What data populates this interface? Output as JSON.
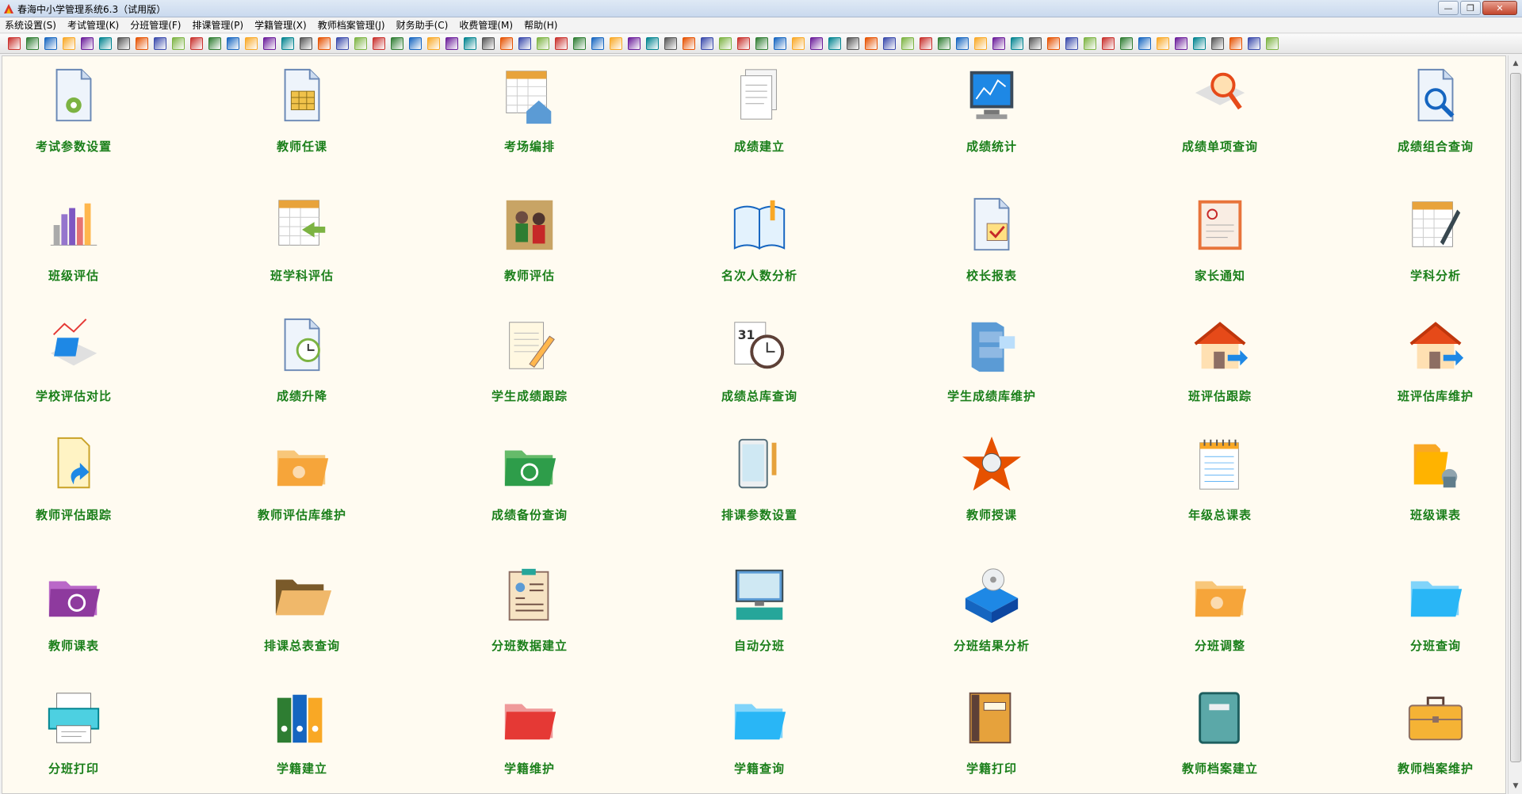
{
  "window": {
    "title": "春海中小学管理系统6.3（试用版）"
  },
  "menu": [
    "系统设置(S)",
    "考试管理(K)",
    "分班管理(F)",
    "排课管理(P)",
    "学籍管理(X)",
    "教师档案管理(J)",
    "财务助手(C)",
    "收费管理(M)",
    "帮助(H)"
  ],
  "tiles": [
    {
      "label": "考试参数设置",
      "icon": "document-settings-icon"
    },
    {
      "label": "教师任课",
      "icon": "document-table-icon"
    },
    {
      "label": "考场编排",
      "icon": "calendar-house-icon"
    },
    {
      "label": "成绩建立",
      "icon": "document-stack-icon"
    },
    {
      "label": "成绩统计",
      "icon": "monitor-chart-icon"
    },
    {
      "label": "成绩单项查询",
      "icon": "magnifier-paper-icon"
    },
    {
      "label": "成绩组合查询",
      "icon": "document-search-icon"
    },
    {
      "label": "班级评估",
      "icon": "bar-chart-icon"
    },
    {
      "label": "班学科评估",
      "icon": "calendar-arrow-icon"
    },
    {
      "label": "教师评估",
      "icon": "teachers-photo-icon"
    },
    {
      "label": "名次人数分析",
      "icon": "open-book-icon"
    },
    {
      "label": "校长报表",
      "icon": "document-check-icon"
    },
    {
      "label": "家长通知",
      "icon": "letter-icon"
    },
    {
      "label": "学科分析",
      "icon": "calendar-pen-icon"
    },
    {
      "label": "学校评估对比",
      "icon": "trend-chart-icon"
    },
    {
      "label": "成绩升降",
      "icon": "document-clock-icon"
    },
    {
      "label": "学生成绩跟踪",
      "icon": "notepad-pen-icon"
    },
    {
      "label": "成绩总库查询",
      "icon": "calendar-clock-icon"
    },
    {
      "label": "学生成绩库维护",
      "icon": "cabinet-icon"
    },
    {
      "label": "班评估跟踪",
      "icon": "house-arrow-icon"
    },
    {
      "label": "班评估库维护",
      "icon": "house-arrow-icon"
    },
    {
      "label": "教师评估跟踪",
      "icon": "document-arrow-icon"
    },
    {
      "label": "教师评估库维护",
      "icon": "orange-folder-icon"
    },
    {
      "label": "成绩备份查询",
      "icon": "green-folder-icon"
    },
    {
      "label": "排课参数设置",
      "icon": "tablet-pen-icon"
    },
    {
      "label": "教师授课",
      "icon": "star-portrait-icon"
    },
    {
      "label": "年级总课表",
      "icon": "spiral-notepad-icon"
    },
    {
      "label": "班级课表",
      "icon": "folder-lock-icon"
    },
    {
      "label": "教师课表",
      "icon": "purple-folder-icon"
    },
    {
      "label": "排课总表查询",
      "icon": "open-folder-icon"
    },
    {
      "label": "分班数据建立",
      "icon": "clipboard-person-icon"
    },
    {
      "label": "自动分班",
      "icon": "computer-icon"
    },
    {
      "label": "分班结果分析",
      "icon": "toolbox-disc-icon"
    },
    {
      "label": "分班调整",
      "icon": "orange-folder-icon"
    },
    {
      "label": "分班查询",
      "icon": "blue-folder-icon"
    },
    {
      "label": "分班打印",
      "icon": "printer-icon"
    },
    {
      "label": "学籍建立",
      "icon": "binders-icon"
    },
    {
      "label": "学籍维护",
      "icon": "red-folder-icon"
    },
    {
      "label": "学籍查询",
      "icon": "blue-folder-icon"
    },
    {
      "label": "学籍打印",
      "icon": "binder-icon"
    },
    {
      "label": "教师档案建立",
      "icon": "notebook-icon"
    },
    {
      "label": "教师档案维护",
      "icon": "briefcase-icon"
    }
  ],
  "colors": {
    "background": "#fffbf1",
    "label": "#1a7f1a"
  }
}
